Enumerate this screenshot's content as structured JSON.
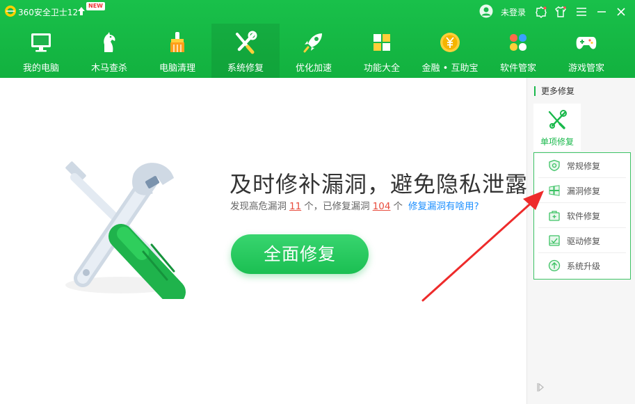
{
  "window": {
    "app_title": "360安全卫士12",
    "new_badge": "NEW",
    "login_text": "未登录"
  },
  "nav": {
    "items": [
      {
        "label": "我的电脑",
        "icon": "monitor-icon"
      },
      {
        "label": "木马查杀",
        "icon": "horse-icon"
      },
      {
        "label": "电脑清理",
        "icon": "broom-icon"
      },
      {
        "label": "系统修复",
        "icon": "wrench-screwdriver-icon",
        "active": true
      },
      {
        "label": "优化加速",
        "icon": "rocket-icon"
      },
      {
        "label": "功能大全",
        "icon": "grid-icon"
      },
      {
        "label": "金融 • 互助宝",
        "icon": "coin-yuan-icon"
      },
      {
        "label": "软件管家",
        "icon": "flower-grid-icon"
      },
      {
        "label": "游戏管家",
        "icon": "gamepad-icon"
      }
    ]
  },
  "main": {
    "title": "及时修补漏洞，避免隐私泄露",
    "sub_prefix": "发现高危漏洞",
    "high_risk_count": "11",
    "sub_mid": "个，已修复漏洞",
    "fixed_count": "104",
    "sub_suffix": "个",
    "help_link": "修复漏洞有啥用?",
    "repair_button": "全面修复"
  },
  "sidebar": {
    "title": "更多修复",
    "single_repair": "单项修复",
    "menu": [
      {
        "label": "常规修复",
        "icon": "shield-icon"
      },
      {
        "label": "漏洞修复",
        "icon": "windows-icon"
      },
      {
        "label": "软件修复",
        "icon": "toolbox-icon"
      },
      {
        "label": "驱动修复",
        "icon": "chip-icon"
      },
      {
        "label": "系统升级",
        "icon": "upgrade-arrow-icon"
      }
    ]
  },
  "colors": {
    "brand_green": "#19b84b",
    "alert_red": "#e84c3d",
    "link_blue": "#1e90ff"
  }
}
